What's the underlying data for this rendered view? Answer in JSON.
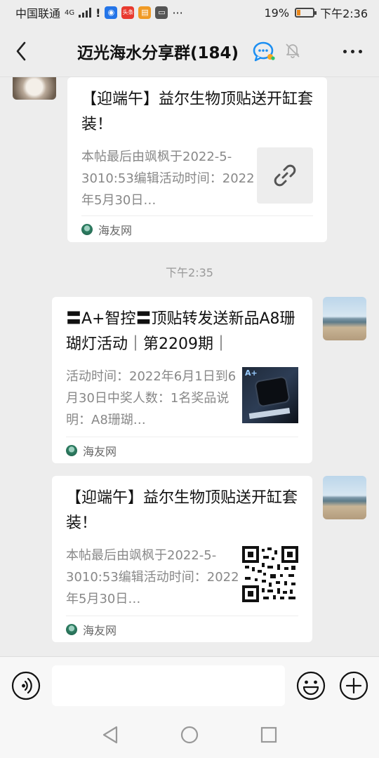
{
  "status_bar": {
    "carrier": "中国联通",
    "network": "4G",
    "battery": "19%",
    "time": "下午2:36",
    "app_badge_text": "头条"
  },
  "header": {
    "title": "迈光海水分享群(184)"
  },
  "messages": [
    {
      "title": "【迎端午】益尔生物顶贴送开缸套装！",
      "desc": "本帖最后由飒枫于2022-5-3010:53编辑活动时间：2022年5月30日…",
      "source": "海友网",
      "thumb": "link-icon"
    },
    {
      "time": "下午2:35"
    },
    {
      "title": "〓A+智控〓顶贴转发送新品A8珊 瑚灯活动｜第2209期｜",
      "desc": "活动时间：2022年6月1日到6月30日中奖人数：1名奖品说明：A8珊瑚…",
      "source": "海友网",
      "thumb": "product-image",
      "thumb_tag": "A+"
    },
    {
      "title": "【迎端午】益尔生物顶贴送开缸套装！",
      "desc": "本帖最后由飒枫于2022-5-3010:53编辑活动时间：2022年5月30日…",
      "source": "海友网",
      "thumb": "qr-code"
    }
  ],
  "input": {
    "placeholder": ""
  },
  "colors": {
    "background": "#ededed",
    "card": "#ffffff",
    "accent_blue": "#1c8ff2",
    "battery_orange": "#e7861b"
  }
}
